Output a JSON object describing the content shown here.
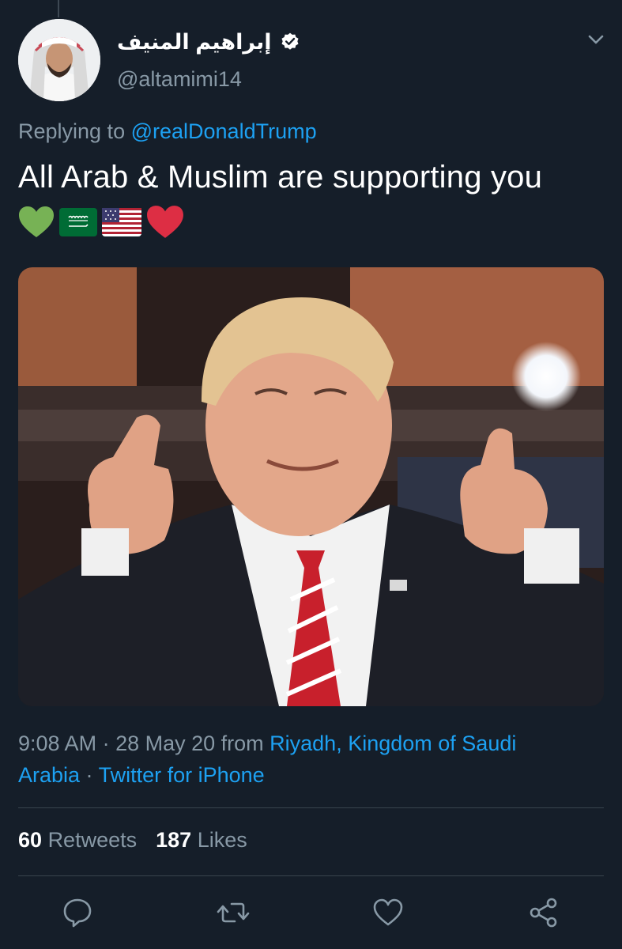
{
  "tweet": {
    "author": {
      "display_name": "إبراهيم المنيف",
      "handle": "@altamimi14",
      "verified": true
    },
    "replying_prefix": "Replying to ",
    "replying_to": "@realDonaldTrump",
    "text": "All Arab & Muslim are supporting you",
    "emojis": [
      "green-heart",
      "saudi-arabia-flag",
      "united-states-flag",
      "red-heart"
    ],
    "media": {
      "description_icon": "photo-thumbs-up"
    },
    "meta": {
      "time": "9:08 AM",
      "separator": " · ",
      "date": "28 May 20",
      "from_word": " from ",
      "location_line1": "Riyadh, Kingdom of Saudi",
      "location_line2": "Arabia",
      "separator2": " · ",
      "source": "Twitter for iPhone"
    },
    "stats": {
      "retweets_count": "60",
      "retweets_label": "Retweets",
      "likes_count": "187",
      "likes_label": "Likes"
    },
    "actions": [
      "reply-icon",
      "retweet-icon",
      "like-icon",
      "share-icon"
    ]
  },
  "colors": {
    "background": "#151e29",
    "text": "#ffffff",
    "secondary": "#8899a6",
    "link": "#1da1f2",
    "divider": "#38444d"
  }
}
